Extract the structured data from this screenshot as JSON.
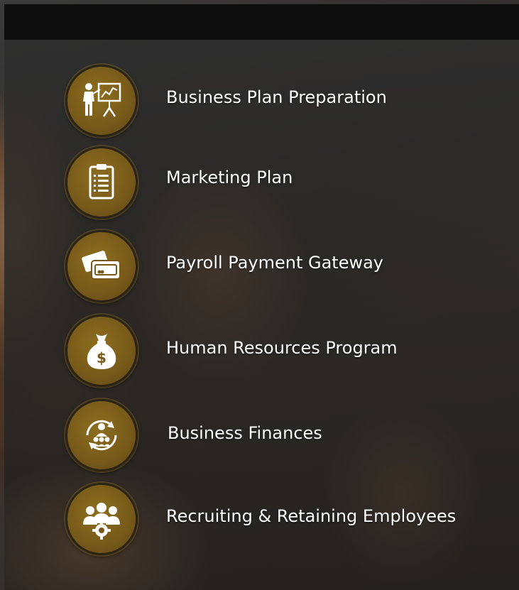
{
  "items": [
    {
      "label": "Business Plan Preparation",
      "icon": "presentation-icon"
    },
    {
      "label": "Marketing Plan",
      "icon": "clipboard-icon"
    },
    {
      "label": "Payroll Payment Gateway",
      "icon": "credit-card-icon"
    },
    {
      "label": "Human Resources Program",
      "icon": "money-bag-icon"
    },
    {
      "label": "Business Finances",
      "icon": "team-cycle-icon"
    },
    {
      "label": "Recruiting & Retaining Employees",
      "icon": "team-gear-icon"
    }
  ],
  "colors": {
    "icon_gold": "#77591a",
    "topbar": "#0d0d0d",
    "text": "#ffffff"
  }
}
